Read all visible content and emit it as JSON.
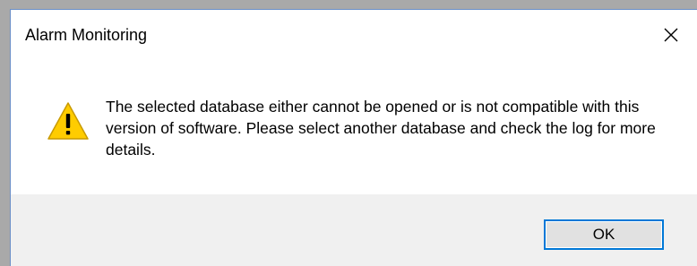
{
  "dialog": {
    "title": "Alarm Monitoring",
    "close_icon": "close-icon",
    "icon": "warning-icon",
    "message": "The selected database either cannot be opened or is not compatible with this version of software. Please select another database and check the log for more details.",
    "ok_label": "OK"
  },
  "colors": {
    "accent": "#0078d7",
    "warning_yellow": "#ffcc00",
    "footer_bg": "#f0f0f0",
    "backdrop": "#a9a9a9"
  }
}
